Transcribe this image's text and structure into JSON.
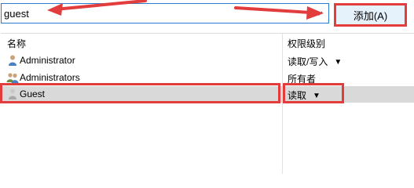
{
  "search": {
    "value": "guest"
  },
  "add_button": {
    "label": "添加(A)"
  },
  "list": {
    "headers": {
      "name": "名称",
      "permission": "权限级别"
    },
    "rows": [
      {
        "name": "Administrator",
        "icon": "user-icon",
        "permission": "读取/写入",
        "has_dropdown": true
      },
      {
        "name": "Administrators",
        "icon": "user-group-icon",
        "permission": "所有者",
        "has_dropdown": false
      },
      {
        "name": "Guest",
        "icon": "guest-user-icon",
        "permission": "读取",
        "has_dropdown": true,
        "selected": true
      }
    ]
  },
  "colors": {
    "annotation": "#e23c3c",
    "accent": "#2a7bd0",
    "selected_row": "#d9d9d9"
  }
}
